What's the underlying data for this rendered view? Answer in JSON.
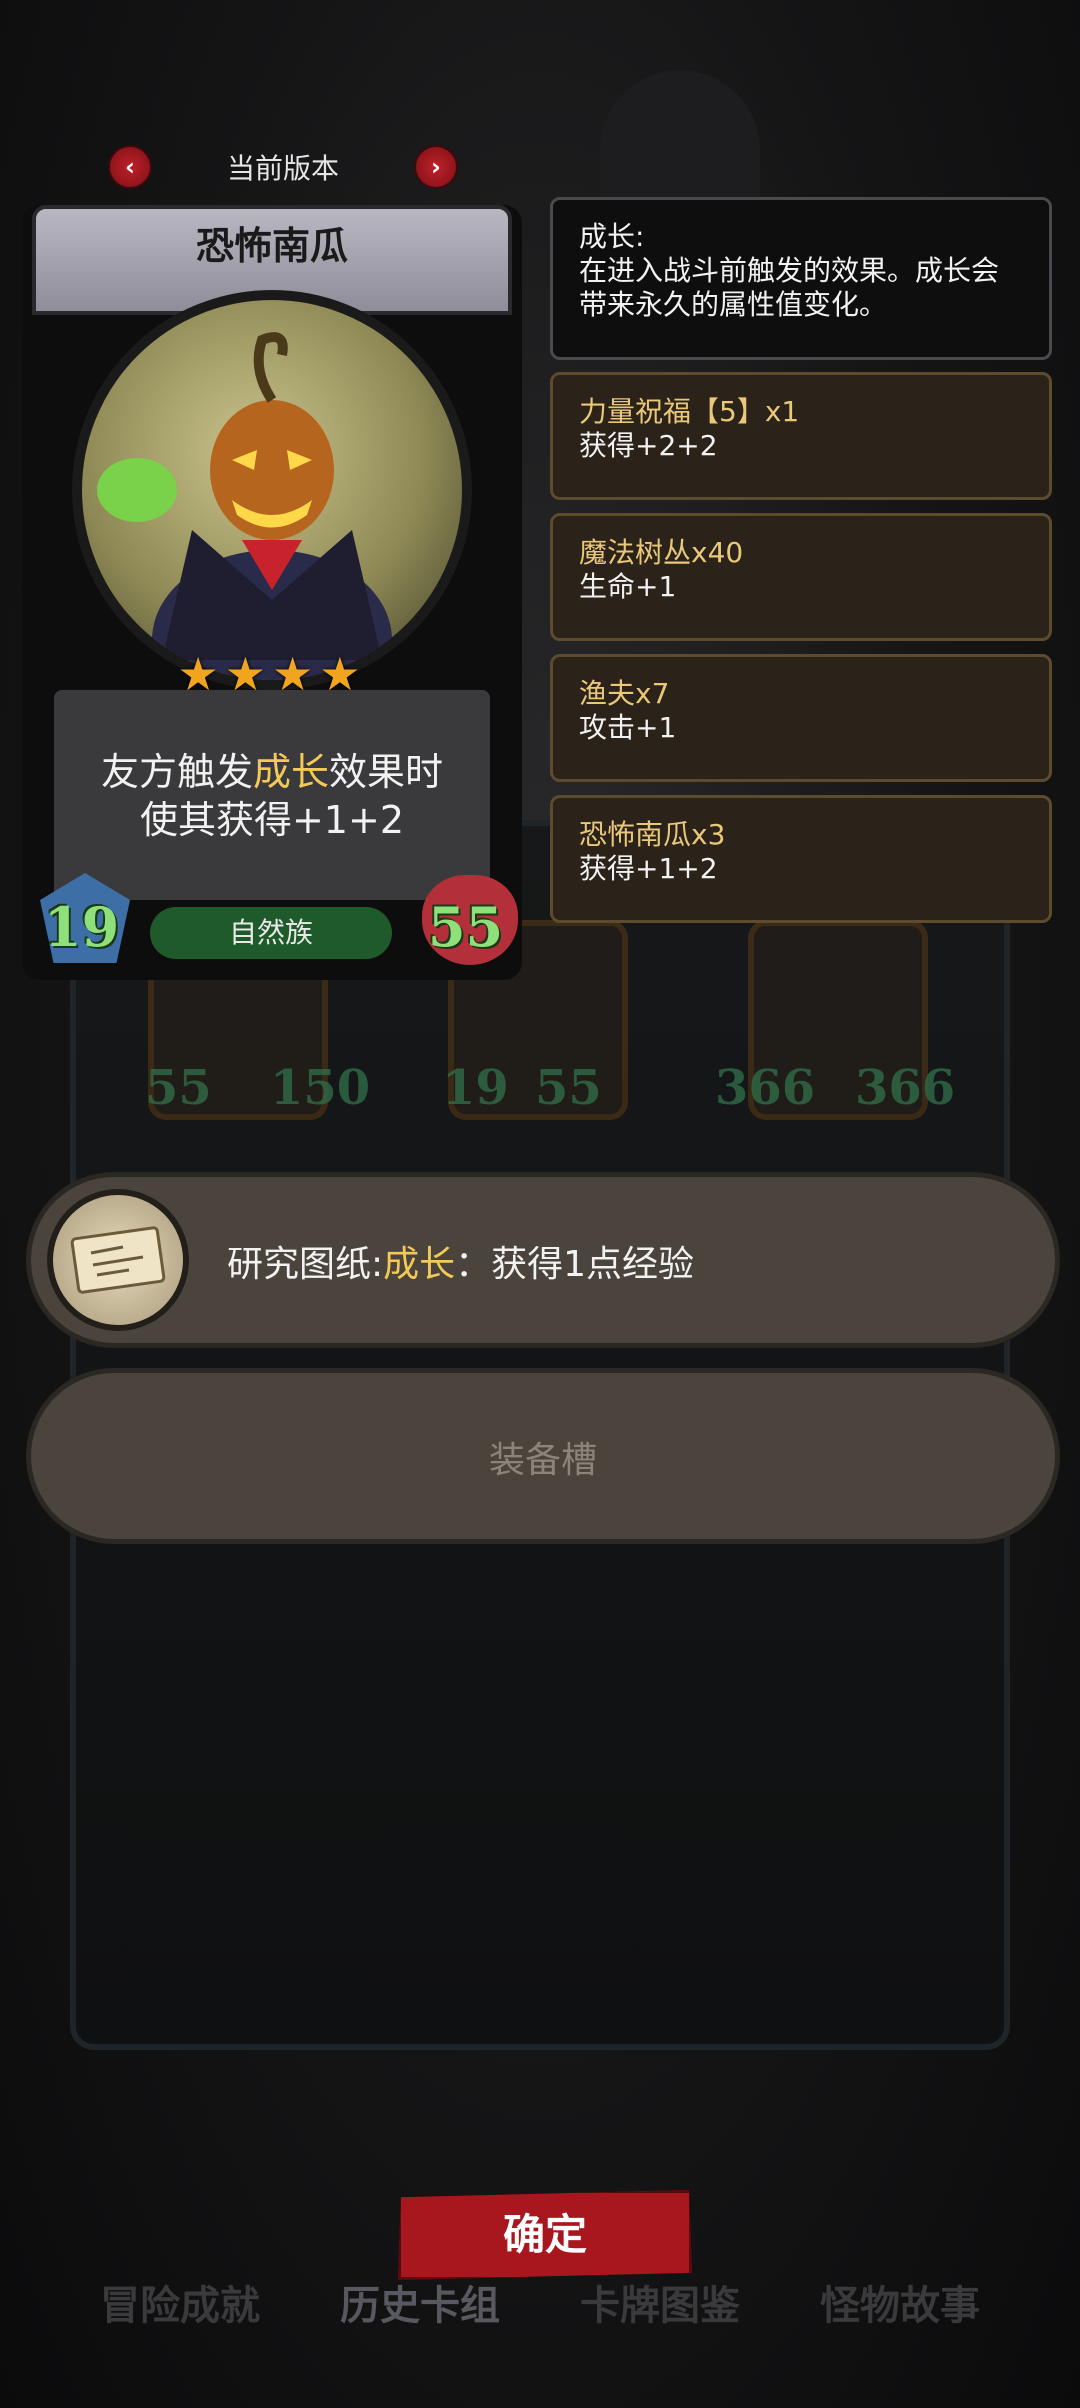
{
  "version": {
    "label": "当前版本",
    "prev_icon": "chevron-left-icon",
    "next_icon": "chevron-right-icon"
  },
  "card": {
    "name": "恐怖南瓜",
    "stars": "★★★★",
    "star_count": 4,
    "ability_pre": "友方触发",
    "ability_keyword": "成长",
    "ability_post": "效果时",
    "ability_line2": "使其获得+1+2",
    "attack": "19",
    "health": "55",
    "tribe": "自然族"
  },
  "keyword_panel": {
    "title": "成长:",
    "description": "在进入战斗前触发的效果。成长会带来永久的属性值变化。"
  },
  "buffs": [
    {
      "title": "力量祝福【5】x1",
      "effect": "获得+2+2"
    },
    {
      "title": "魔法树丛x40",
      "effect": "生命+1"
    },
    {
      "title": "渔夫x7",
      "effect": "攻击+1"
    },
    {
      "title": "恐怖南瓜x3",
      "effect": "获得+1+2"
    }
  ],
  "background_minis": [
    {
      "attack": "55",
      "health": "150"
    },
    {
      "attack": "19",
      "health": "55"
    },
    {
      "attack": "366",
      "health": "366"
    }
  ],
  "equipment": {
    "item_prefix": "研究图纸:",
    "item_keyword": "成长",
    "item_suffix": "：获得1点经验",
    "item_icon": "blueprint-scroll-icon",
    "empty_slot_label": "装备槽"
  },
  "confirm_label": "确定",
  "bottom_nav": [
    "冒险成就",
    "历史卡组",
    "卡牌图鉴",
    "怪物故事"
  ],
  "colors": {
    "highlight": "#f3c95a",
    "stat_green": "#8fe07a",
    "confirm_red": "#a8161e"
  }
}
